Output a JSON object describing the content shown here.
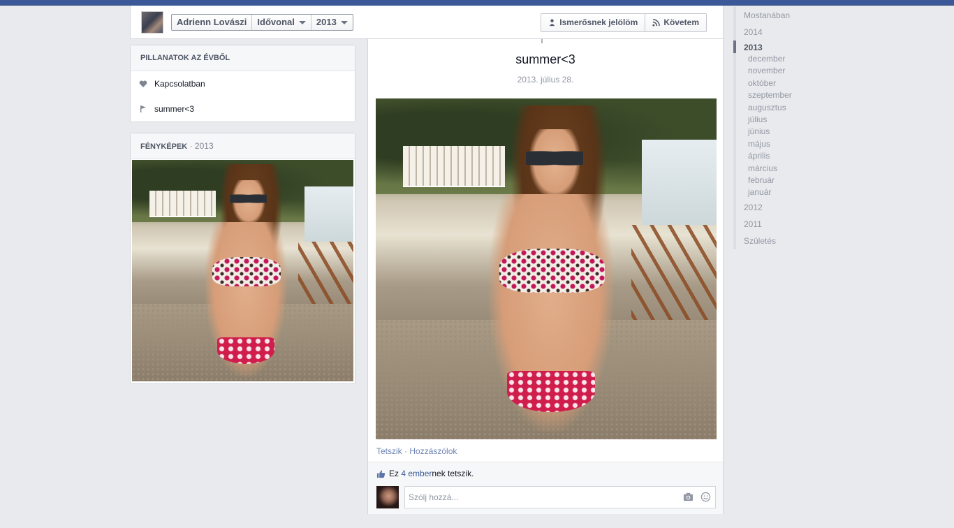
{
  "header": {
    "name": "Adrienn Lovászi",
    "section": "Idővonal",
    "year": "2013",
    "add_friend_label": "Ismerősnek jelölöm",
    "follow_label": "Követem"
  },
  "moments": {
    "title": "PILLANATOK AZ ÉVBŐL",
    "items": [
      {
        "label": "Kapcsolatban",
        "icon": "heart-icon"
      },
      {
        "label": "summer<3",
        "icon": "flag-icon"
      }
    ]
  },
  "photos": {
    "title": "FÉNYKÉPEK",
    "sep": " · ",
    "year": "2013"
  },
  "post": {
    "title": "summer<3",
    "date": "2013. július 28.",
    "like_label": "Tetszik",
    "sep": " · ",
    "comments_label": "Hozzászólok",
    "likes_prefix": "Ez ",
    "likes_count_link": "4 ember",
    "likes_suffix": "nek tetszik.",
    "comment_placeholder": "Szólj hozzá..."
  },
  "timeline": {
    "recent": "Mostanában",
    "years_before": [
      "2014"
    ],
    "active_year": "2013",
    "months": [
      "december",
      "november",
      "október",
      "szeptember",
      "augusztus",
      "július",
      "június",
      "május",
      "április",
      "március",
      "február",
      "január"
    ],
    "years_after": [
      "2012",
      "2011"
    ],
    "birth": "Születés"
  },
  "colors": {
    "brand": "#3b5998",
    "link": "#3b5998",
    "muted": "#9197a3"
  }
}
